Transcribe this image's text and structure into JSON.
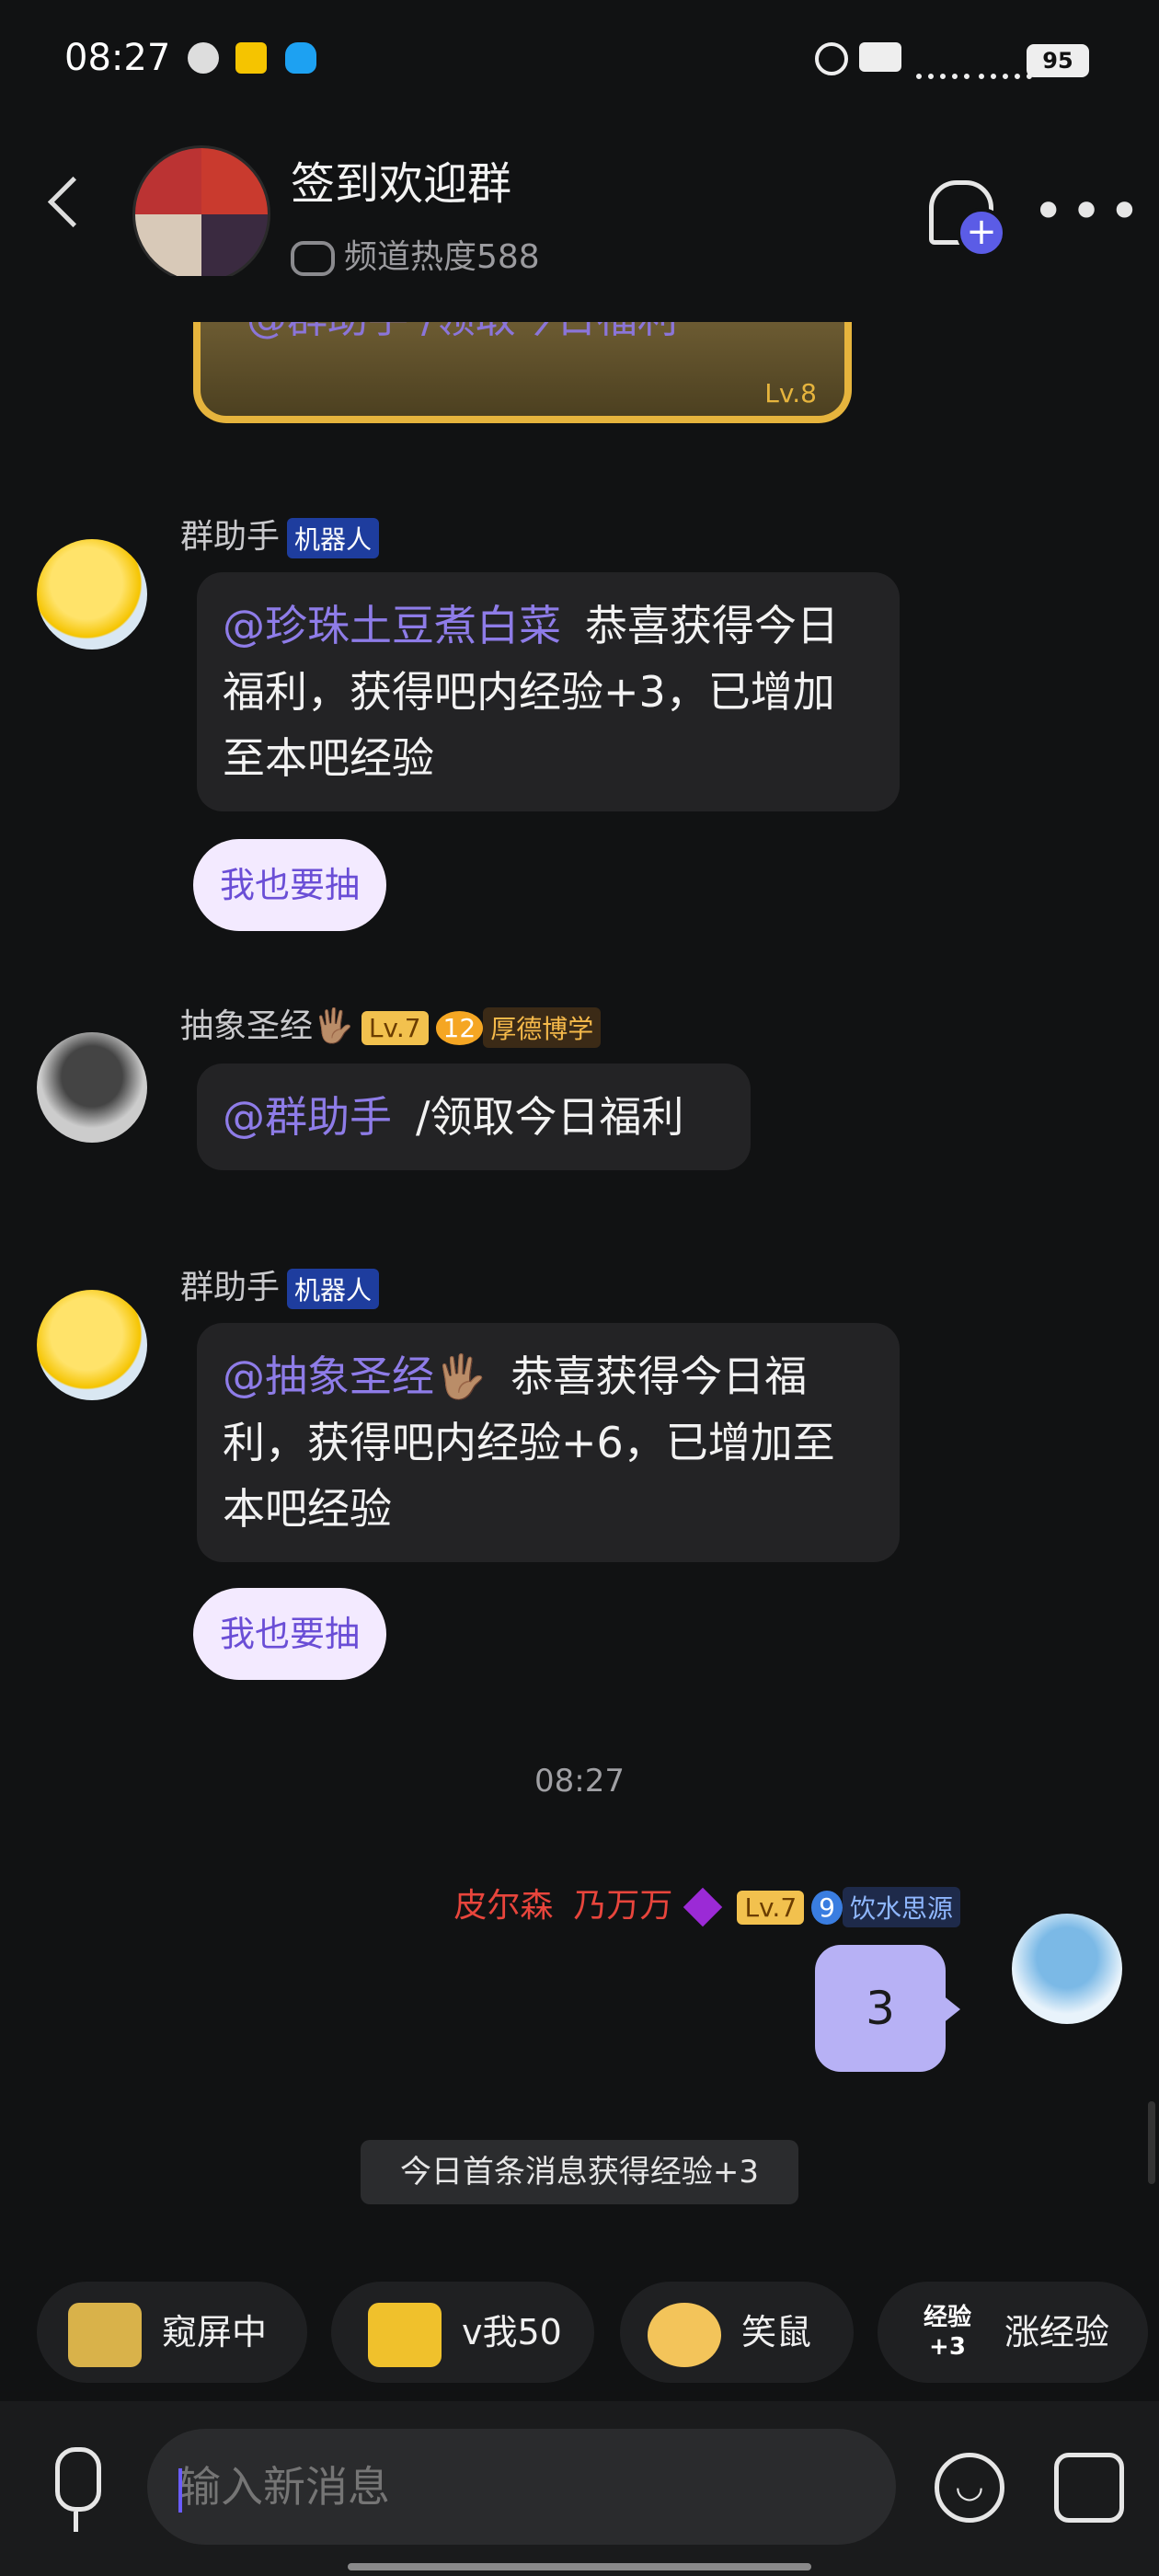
{
  "status_bar": {
    "time": "08:27",
    "battery": "95",
    "icons": [
      "vpn-icon",
      "news-app-icon",
      "qq-icon",
      "alarm-icon",
      "hd-icon",
      "5g-signal-icon",
      "5g-signal-icon"
    ]
  },
  "header": {
    "title": "签到欢迎群",
    "heat_text": "频道热度588"
  },
  "top_card": {
    "text": "@群助手 /领取今日福利",
    "level": "Lv.8"
  },
  "messages": [
    {
      "sender": "群助手",
      "badges": [
        "机器人"
      ],
      "mention": "@珍珠土豆煮白菜",
      "text": "恭喜获得今日福利，获得吧内经验+3，已增加至本吧经验",
      "action": "我也要抽"
    },
    {
      "sender": "抽象圣经🖐🏽",
      "badges": [
        "Lv.7",
        "12",
        "厚德博学"
      ],
      "mention": "@群助手",
      "text": "/领取今日福利"
    },
    {
      "sender": "群助手",
      "badges": [
        "机器人"
      ],
      "mention": "@抽象圣经🖐🏽",
      "text": "恭喜获得今日福利，获得吧内经验+6，已增加至本吧经验",
      "action": "我也要抽"
    }
  ],
  "timestamp": "08:27",
  "my_message": {
    "name1": "皮尔森",
    "name2": "乃万万",
    "badges": [
      "Lv.7",
      "9",
      "饮水思源"
    ],
    "text": "3"
  },
  "system_note": "今日首条消息获得经验+3",
  "sticker_chips": [
    "窥屏中",
    "v我50",
    "笑鼠",
    "涨经验"
  ],
  "sticker_chip_art": "经验+3",
  "input": {
    "placeholder": "输入新消息"
  },
  "colors": {
    "background": "#111213",
    "bubble": "#232325",
    "mention": "#8e7ce8",
    "my_bubble": "#b7b1f5",
    "name_red": "#e8453c",
    "gold": "#e6b43d"
  }
}
